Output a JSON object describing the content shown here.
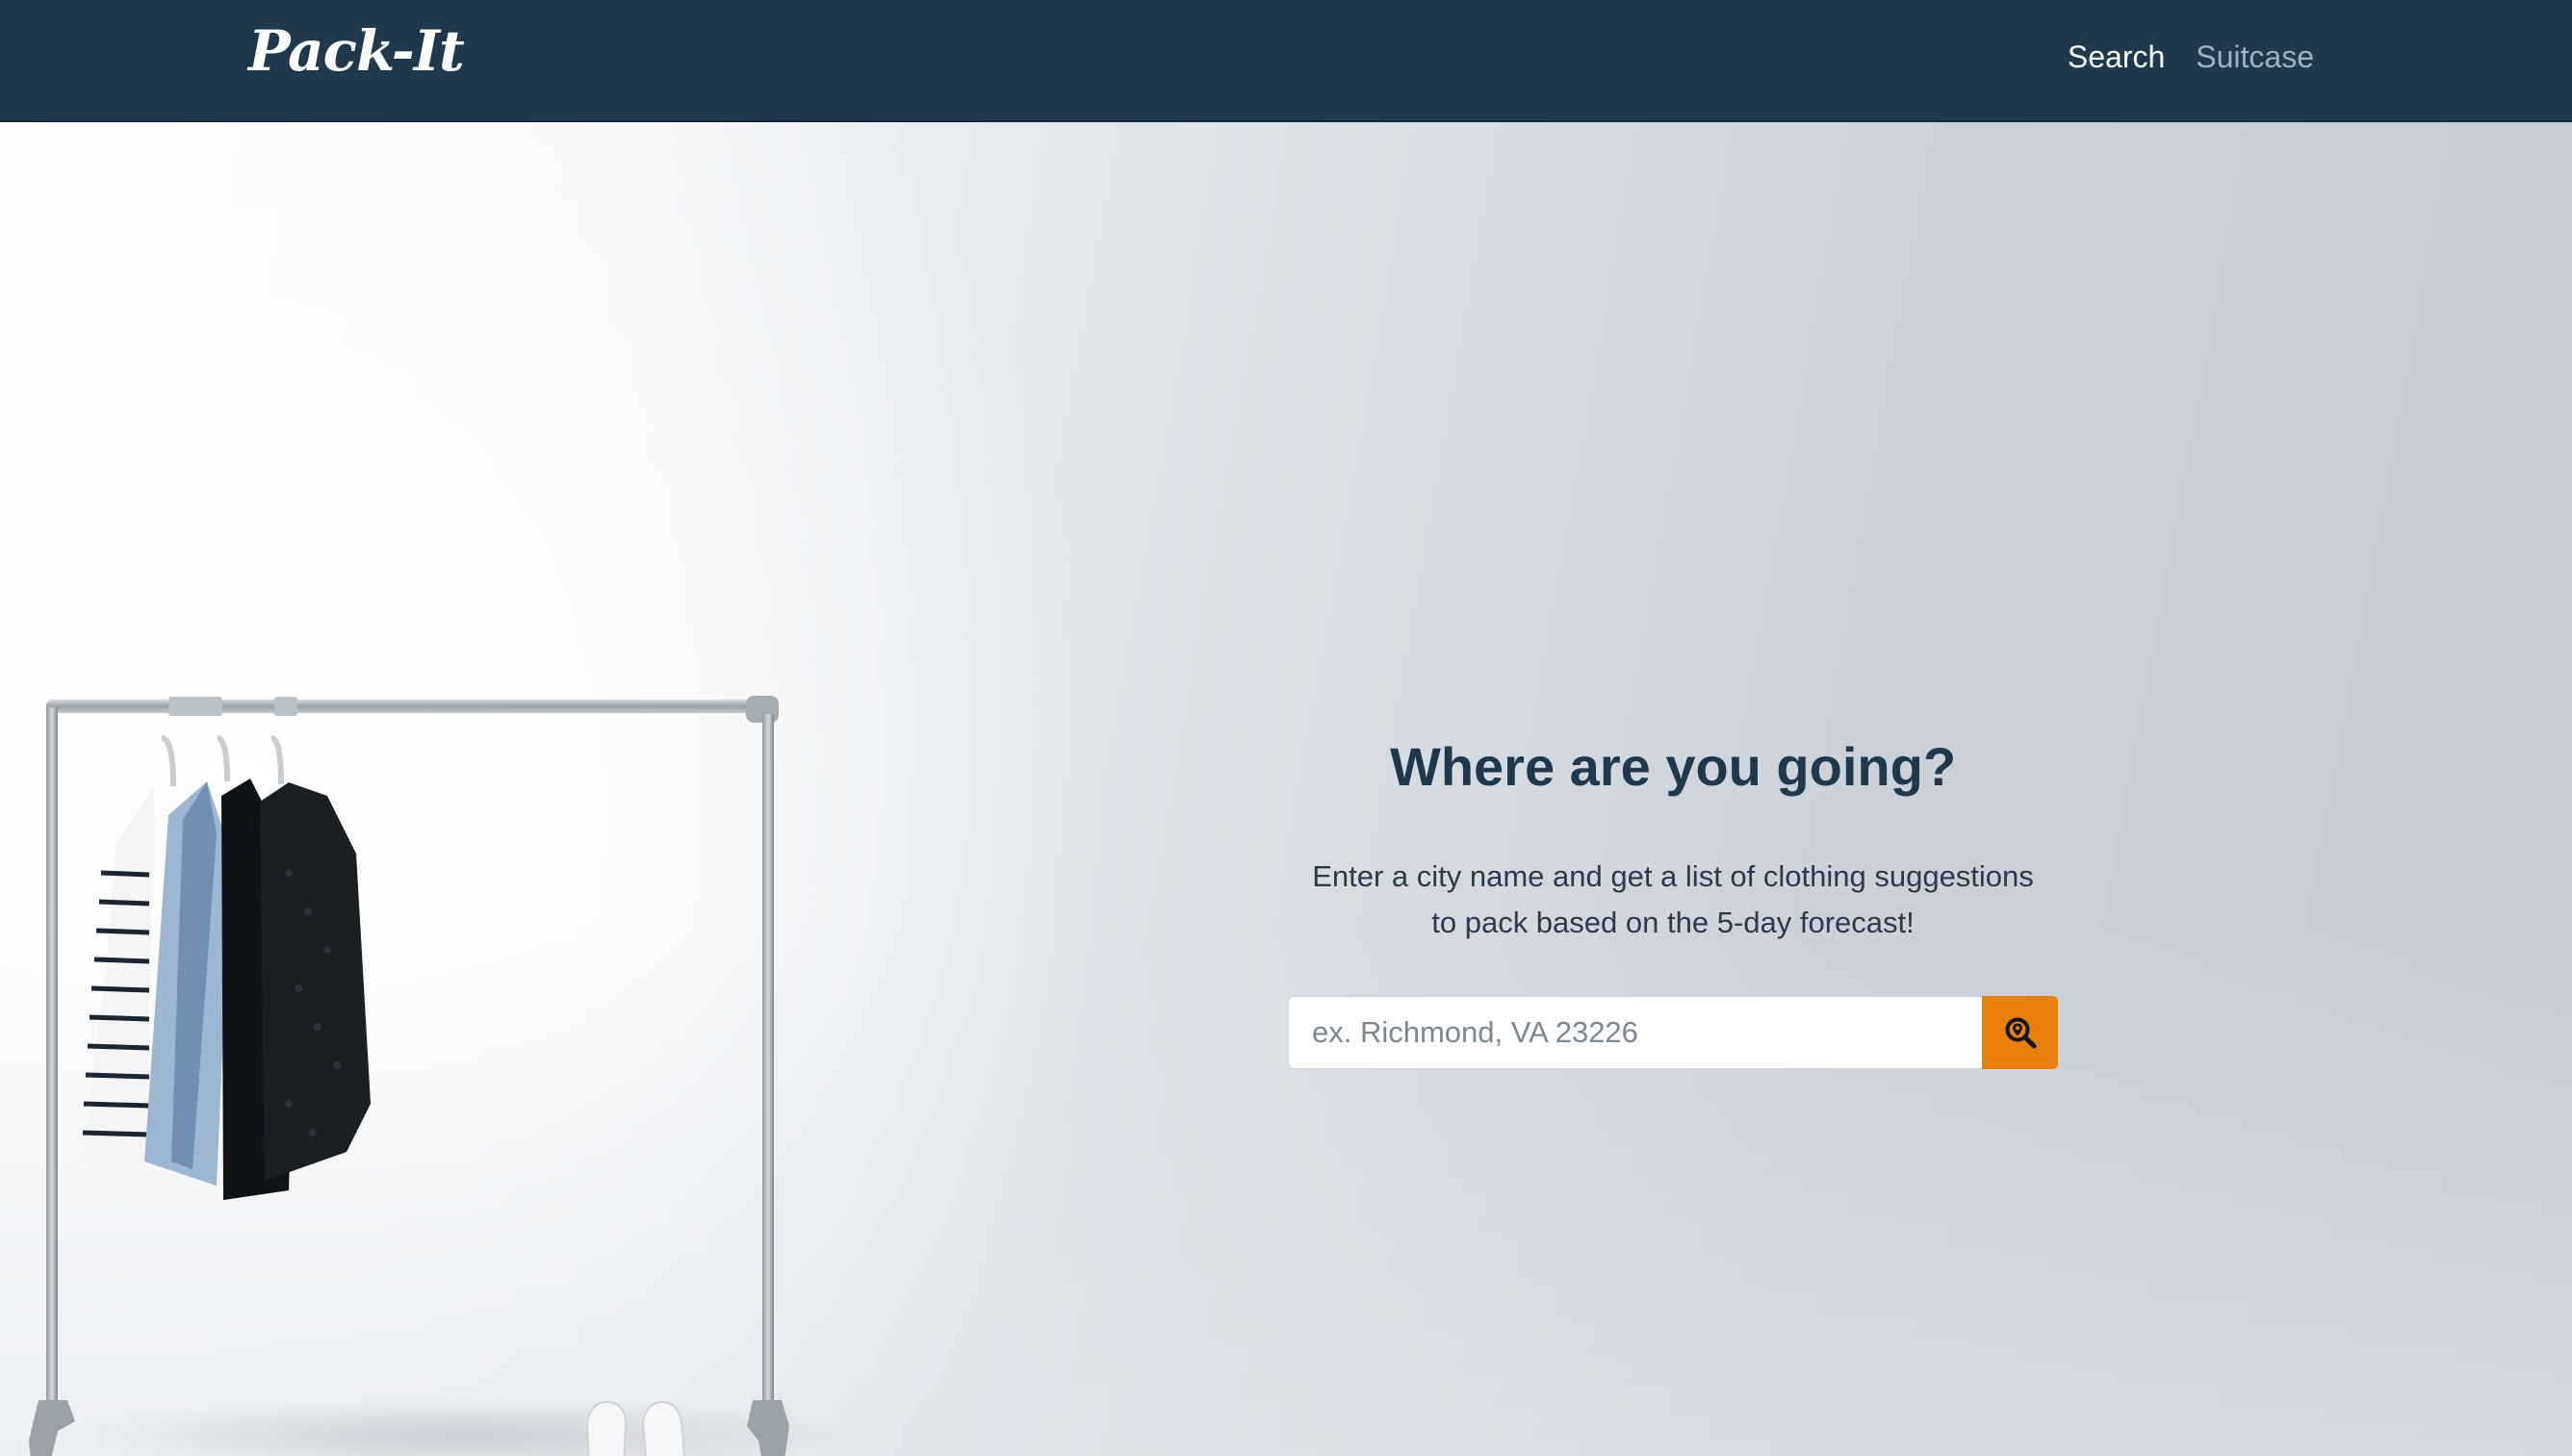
{
  "navbar": {
    "brand": "Pack-It",
    "links": [
      {
        "label": "Search",
        "state": "active"
      },
      {
        "label": "Suitcase",
        "state": "muted"
      }
    ],
    "background_color": "#1f384c"
  },
  "hero": {
    "headline": "Where are you going?",
    "subtext_line1": "Enter a city name and get a list of clothing suggestions",
    "subtext_line2": "to pack based on the 5-day forecast!",
    "search": {
      "placeholder": "ex. Richmond, VA 23226",
      "value": "",
      "button_icon": "search-location-icon",
      "button_color": "#e8800b"
    }
  }
}
